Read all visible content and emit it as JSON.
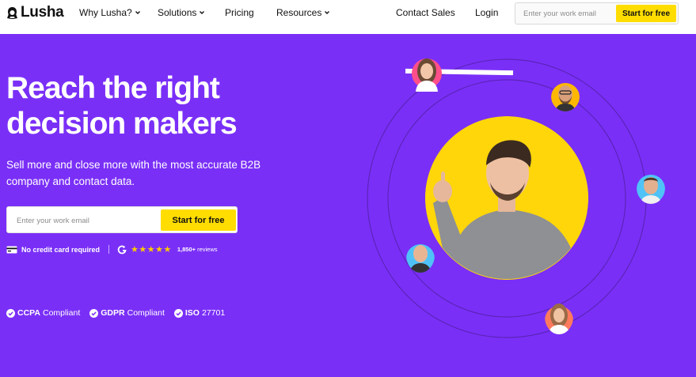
{
  "nav": {
    "logo_text": "Lusha",
    "items": [
      {
        "label": "Why Lusha?",
        "has_dropdown": true
      },
      {
        "label": "Solutions",
        "has_dropdown": true
      },
      {
        "label": "Pricing",
        "has_dropdown": false
      },
      {
        "label": "Resources",
        "has_dropdown": true
      }
    ],
    "contact_sales": "Contact Sales",
    "login": "Login",
    "email_placeholder": "Enter your work email",
    "cta": "Start for free"
  },
  "hero": {
    "headline_line1": "Reach the right",
    "headline_line2": "decision makers",
    "subhead": "Sell more and close more with the most accurate B2B company and contact data.",
    "email_placeholder": "Enter your work email",
    "cta": "Start for free",
    "no_card": "No credit card required",
    "stars": "★★★★★",
    "reviews_count": "1,850+",
    "reviews_label": "reviews",
    "compliance": [
      {
        "bold": "CCPA",
        "rest": "Compliant"
      },
      {
        "bold": "GDPR",
        "rest": "Compliant"
      },
      {
        "bold": "ISO",
        "rest": "27701"
      }
    ]
  },
  "colors": {
    "brand_purple": "#7a2ff7",
    "accent_yellow": "#ffdd00",
    "star_yellow": "#ffcc00"
  },
  "icons": [
    "lusha-logo-icon",
    "chevron-down-icon",
    "credit-card-icon",
    "g2-icon",
    "star-icon",
    "check-circle-icon"
  ]
}
